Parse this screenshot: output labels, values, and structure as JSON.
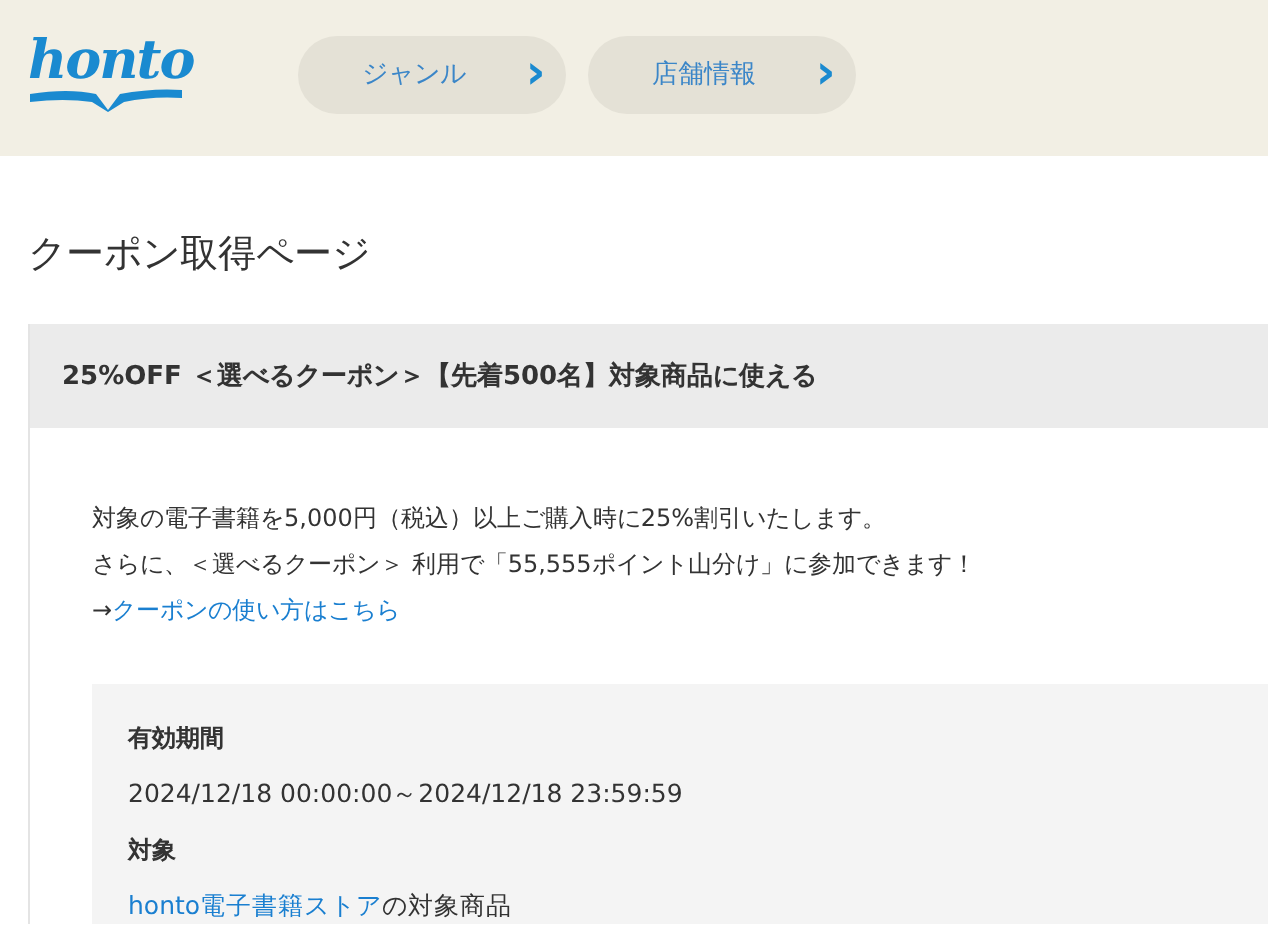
{
  "header": {
    "logo": "honto",
    "nav": [
      {
        "label": "ジャンル",
        "chevron": "›"
      },
      {
        "label": "店舗情報",
        "chevron": "›"
      }
    ]
  },
  "page_title": "クーポン取得ページ",
  "coupon": {
    "title": "25%OFF ＜選べるクーポン＞【先着500名】対象商品に使える",
    "description": [
      "対象の電子書籍を5,000円（税込）以上ご購入時に25%割引いたします。",
      "さらに、＜選べるクーポン＞ 利用で「55,555ポイント山分け」に参加できます！"
    ],
    "howto": {
      "prefix": "→",
      "link": "クーポンの使い方はこちら"
    },
    "details": [
      {
        "label": "有効期間",
        "value": "2024/12/18 00:00:00～2024/12/18 23:59:59"
      },
      {
        "label": "対象",
        "link": "honto電子書籍ストア",
        "value": "の対象商品"
      }
    ]
  }
}
